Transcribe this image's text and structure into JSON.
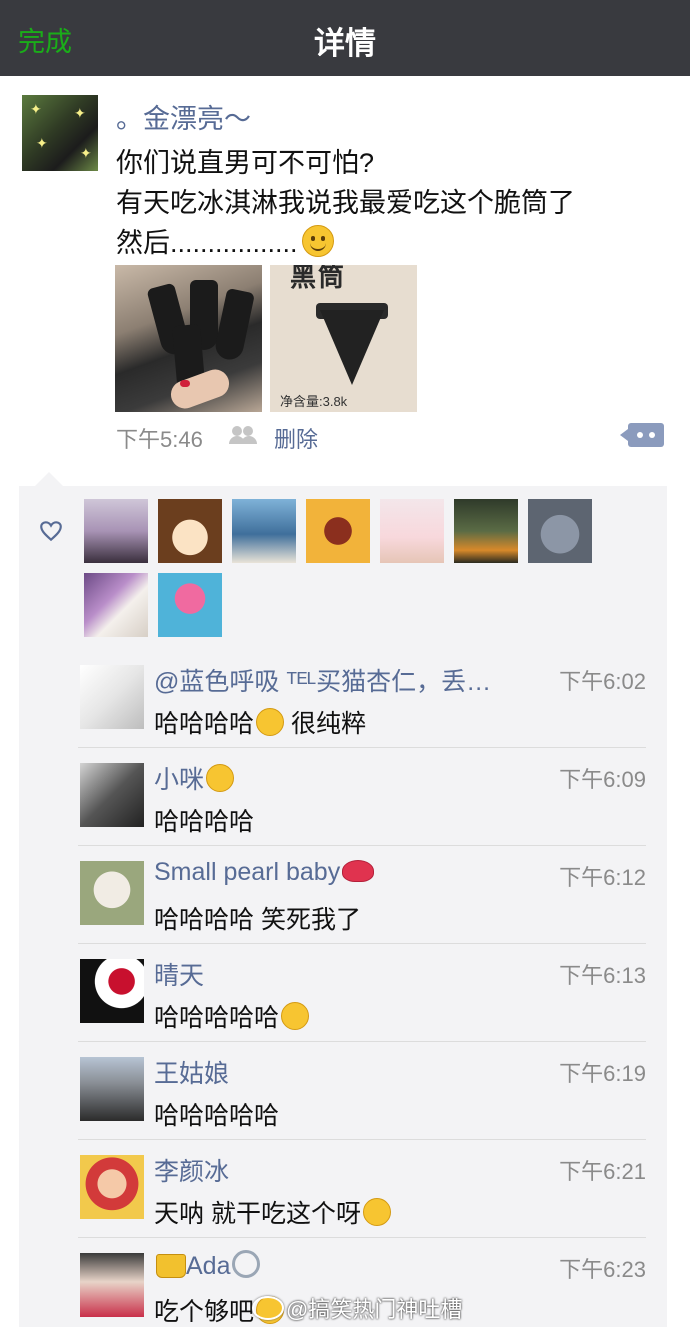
{
  "nav": {
    "done": "完成",
    "title": "详情"
  },
  "post": {
    "author": "。金漂亮～",
    "text_lines": [
      "你们说直男可不可怕?",
      "有天吃冰淇淋我说我最爱吃这个脆筒了",
      "然后................."
    ],
    "time": "下午5:46",
    "delete": "删除",
    "photo2_title": "黑筒",
    "photo2_net": "净含量:3.8k"
  },
  "comments": [
    {
      "name": "@蓝色呼吸 ᵀᴱᴸ买猫杏仁，丢…",
      "time": "下午6:02",
      "text": "哈哈哈哈",
      "text_after": " 很纯粹",
      "emoji": "laugh-cry-emoji"
    },
    {
      "name": "小咪",
      "time": "下午6:09",
      "text": "哈哈哈哈",
      "name_emoji": "smirk-emoji"
    },
    {
      "name": "Small pearl baby",
      "time": "下午6:12",
      "text": "哈哈哈哈 笑死我了",
      "name_emoji": "lips-emoji"
    },
    {
      "name": "晴天",
      "time": "下午6:13",
      "text": "哈哈哈哈哈",
      "emoji": "tears-of-joy-emoji"
    },
    {
      "name": "王姑娘",
      "time": "下午6:19",
      "text": "哈哈哈哈哈"
    },
    {
      "name": "李颜冰",
      "time": "下午6:21",
      "text": "天呐 就干吃这个呀",
      "emoji": "thinking-emoji"
    },
    {
      "name": "Ada",
      "time": "下午6:23",
      "text": "吃个够吧",
      "emoji": "sweat-emoji"
    }
  ],
  "watermark": "@搞笑热门神吐槽",
  "colors": {
    "topbar": "#393a3f",
    "done": "#1aad19",
    "link": "#576b95",
    "panel": "#f3f3f5"
  }
}
